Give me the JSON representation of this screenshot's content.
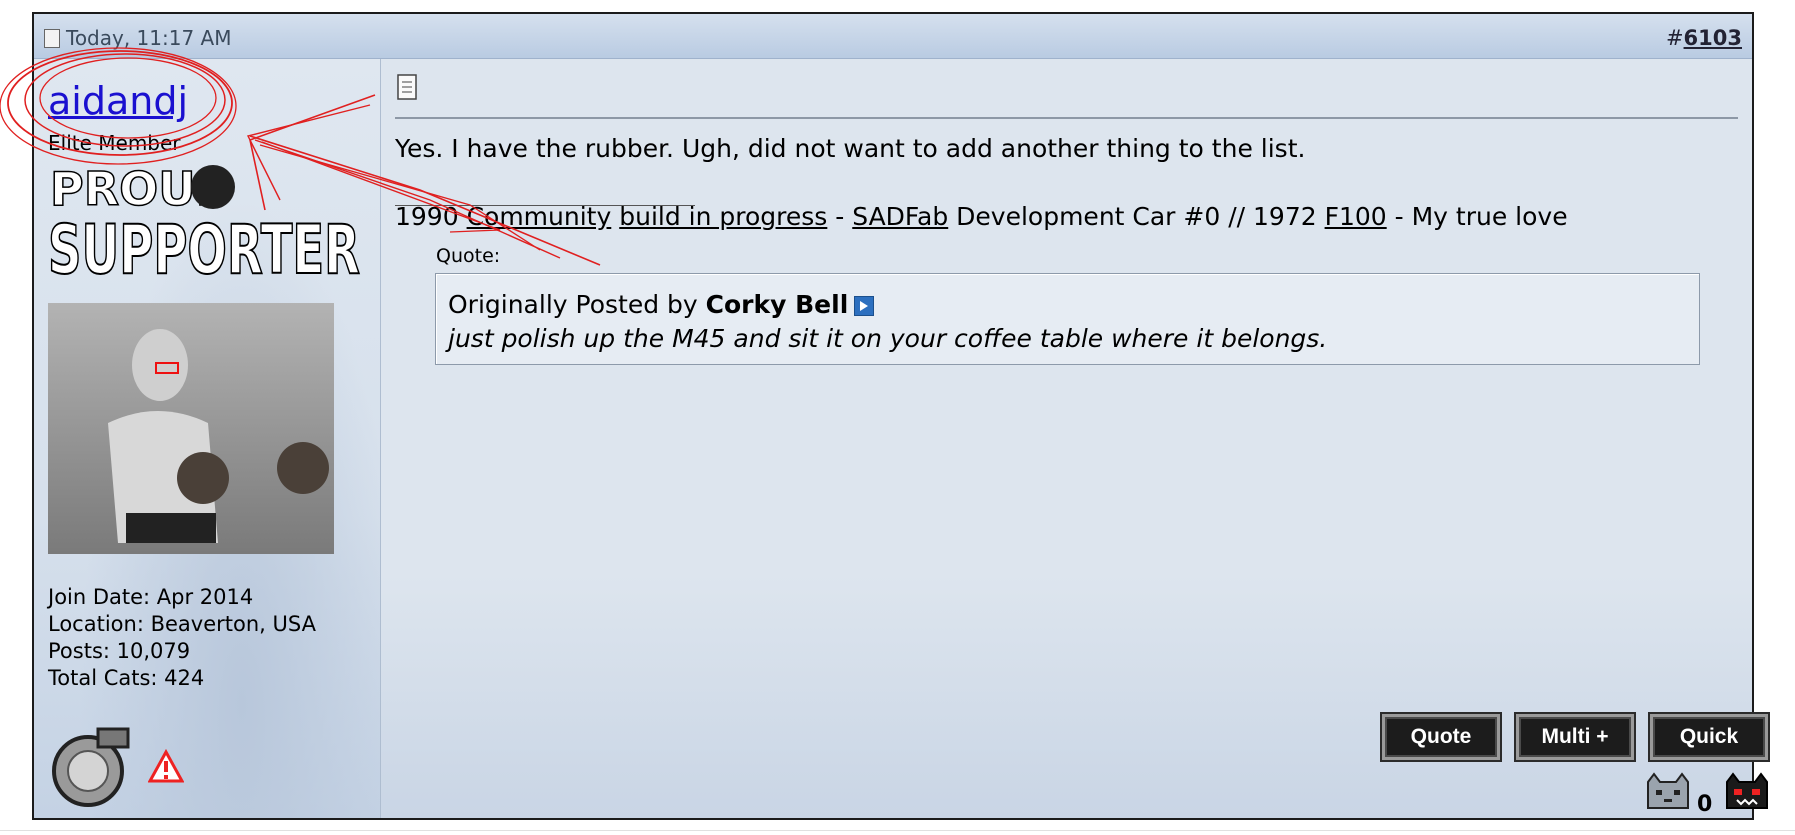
{
  "post": {
    "date": "Today, 11:17 AM",
    "number_prefix": "#",
    "number": "6103"
  },
  "user": {
    "name": "aidandj",
    "title": "Elite Member",
    "badge": "proud-supporter-badge",
    "join_date": "Join Date: Apr 2014",
    "location": "Location: Beaverton, USA",
    "posts": "Posts: 10,079",
    "total_cats": "Total Cats: 424"
  },
  "message": {
    "text": "Yes. I have the rubber. Ugh, did not want to add another thing to the list.",
    "signature": {
      "s1": "1990 ",
      "link_community": "Community",
      "s2": " ",
      "link_build": "build in progress",
      "s3": " - ",
      "link_sadfab": "SADFab",
      "s4": " Development Car #0 // 1972 ",
      "link_f100": "F100",
      "s5": " - My true love"
    },
    "quote": {
      "label": "Quote:",
      "by_prefix": "Originally Posted by ",
      "author": "Corky Bell",
      "text": "just polish up the M45 and sit it on your coffee table where it belongs."
    }
  },
  "buttons": {
    "quote": "Quote",
    "multi": "Multi +",
    "quick": "Quick"
  },
  "cats": {
    "count": "0"
  },
  "colors": {
    "username": "#1a10d0",
    "header": "#c5d4e8",
    "annotation": "#e02020"
  }
}
